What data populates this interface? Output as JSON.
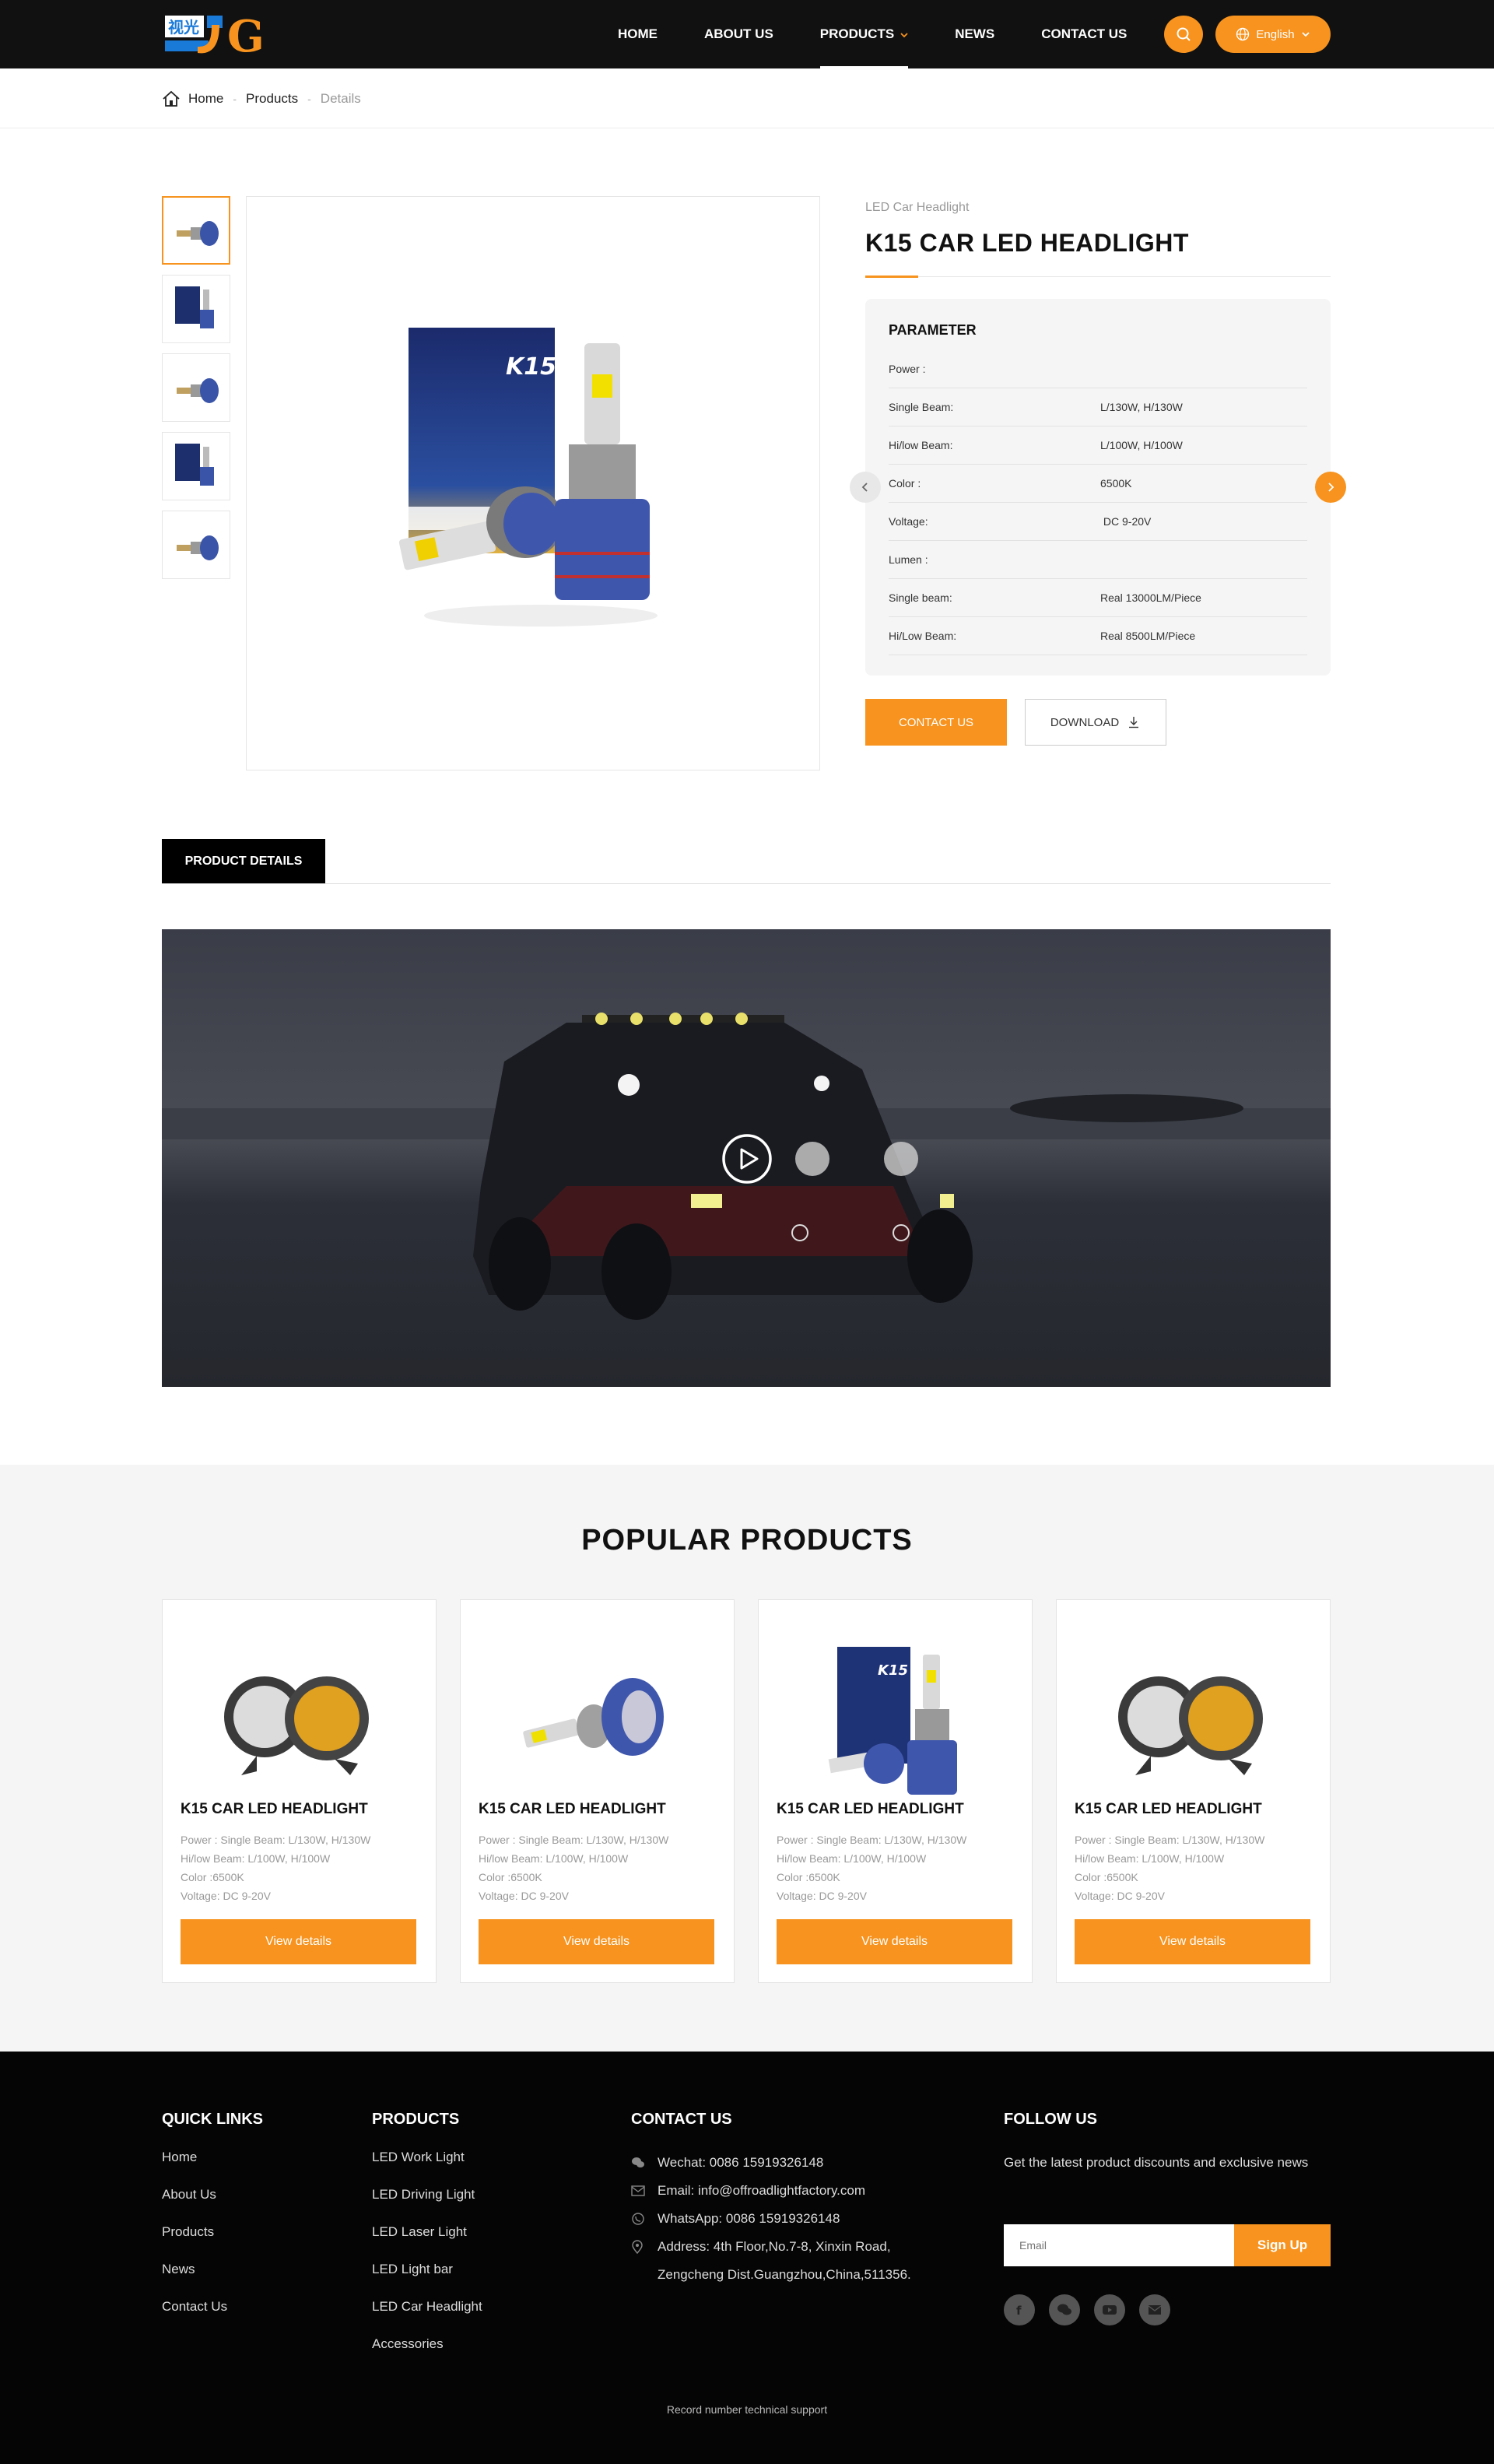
{
  "colors": {
    "accent": "#f7931e",
    "header_bg": "#111111",
    "footer_bg": "#050505",
    "panel_bg": "#f5f5f5"
  },
  "header": {
    "nav": [
      {
        "label": "HOME"
      },
      {
        "label": "ABOUT US"
      },
      {
        "label": "PRODUCTS",
        "active": true
      },
      {
        "label": "NEWS"
      },
      {
        "label": "CONTACT US"
      }
    ],
    "language": "English"
  },
  "breadcrumb": {
    "home": "Home",
    "sep": "-",
    "products": "Products",
    "current": "Details"
  },
  "product": {
    "category": "LED Car Headlight",
    "title": "K15 CAR LED HEADLIGHT",
    "param_title": "PARAMETER",
    "params": [
      {
        "k": "Power :",
        "v": ""
      },
      {
        "k": "Single Beam:",
        "v": "L/130W, H/130W"
      },
      {
        "k": "Hi/low Beam:",
        "v": "L/100W, H/100W"
      },
      {
        "k": "Color :",
        "v": "6500K"
      },
      {
        "k": "Voltage:",
        "v": " DC 9-20V"
      },
      {
        "k": "Lumen :",
        "v": ""
      },
      {
        "k": "Single beam:",
        "v": "Real 13000LM/Piece"
      },
      {
        "k": "Hi/Low Beam:",
        "v": "Real 8500LM/Piece"
      }
    ],
    "contact_btn": "CONTACT US",
    "download_btn": "DOWNLOAD"
  },
  "details_tab": "PRODUCT DETAILS",
  "popular": {
    "title": "POPULAR PRODUCTS",
    "cards": [
      {
        "title": "K15 CAR LED HEADLIGHT",
        "specs": [
          "Power : Single Beam: L/130W, H/130W",
          "Hi/low Beam: L/100W, H/100W",
          "Color :6500K",
          "Voltage: DC 9-20V"
        ],
        "button": "View details",
        "image": "round-work-light"
      },
      {
        "title": "K15 CAR LED HEADLIGHT",
        "specs": [
          "Power : Single Beam: L/130W, H/130W",
          "Hi/low Beam: L/100W, H/100W",
          "Color :6500K",
          "Voltage: DC 9-20V"
        ],
        "button": "View details",
        "image": "led-bulb"
      },
      {
        "title": "K15 CAR LED HEADLIGHT",
        "specs": [
          "Power : Single Beam: L/130W, H/130W",
          "Hi/low Beam: L/100W, H/100W",
          "Color :6500K",
          "Voltage: DC 9-20V"
        ],
        "button": "View details",
        "image": "bulb-with-box"
      },
      {
        "title": "K15 CAR LED HEADLIGHT",
        "specs": [
          "Power : Single Beam: L/130W, H/130W",
          "Hi/low Beam: L/100W, H/100W",
          "Color :6500K",
          "Voltage: DC 9-20V"
        ],
        "button": "View details",
        "image": "round-work-light"
      }
    ]
  },
  "footer": {
    "quick_links": {
      "title": "QUICK LINKS",
      "items": [
        "Home",
        "About Us",
        "Products",
        "News",
        "Contact Us"
      ]
    },
    "products": {
      "title": "PRODUCTS",
      "items": [
        "LED Work Light",
        "LED Driving Light",
        "LED Laser Light",
        "LED Light bar",
        "LED Car Headlight",
        "Accessories"
      ]
    },
    "contact": {
      "title": "CONTACT US",
      "wechat": "Wechat: 0086 15919326148",
      "email": "Email: info@offroadlightfactory.com",
      "whatsapp": "WhatsApp: 0086 15919326148",
      "address_1": "Address: 4th Floor,No.7-8, Xinxin Road,",
      "address_2": "Zengcheng Dist.Guangzhou,China,511356."
    },
    "follow": {
      "title": "FOLLOW US",
      "desc": "Get the latest product discounts and exclusive news",
      "email_placeholder": "Email",
      "signup": "Sign Up",
      "socials": [
        "facebook-icon",
        "wechat-icon",
        "youtube-icon",
        "mail-icon"
      ]
    },
    "record": "Record number technical support"
  }
}
